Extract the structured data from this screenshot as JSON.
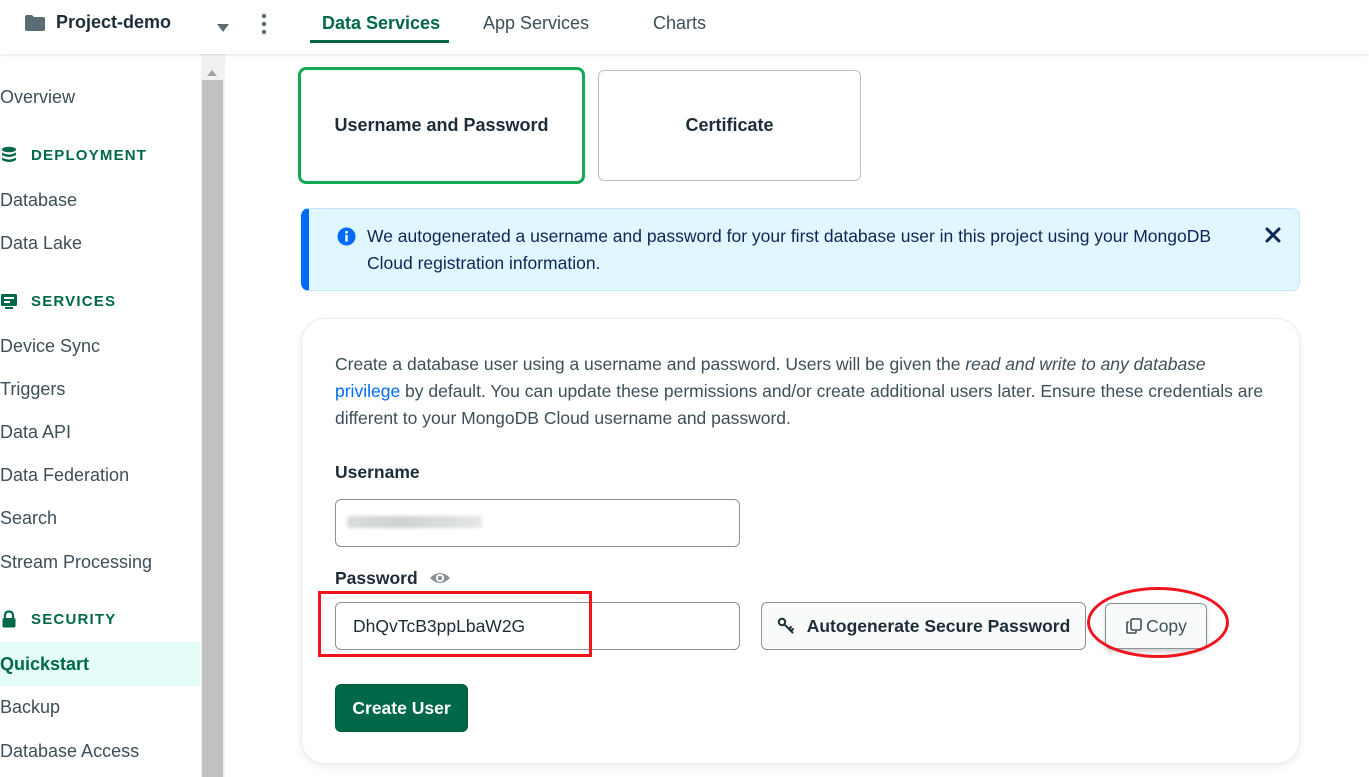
{
  "topbar": {
    "project_name": "Project-demo",
    "tabs": [
      {
        "label": "Data Services",
        "active": true
      },
      {
        "label": "App Services",
        "active": false
      },
      {
        "label": "Charts",
        "active": false
      }
    ],
    "accent_color": "#00684a"
  },
  "sidebar": {
    "overview": "Overview",
    "deployment": {
      "title": "DEPLOYMENT",
      "icon": "database-stack-icon",
      "items": [
        "Database",
        "Data Lake"
      ]
    },
    "services": {
      "title": "SERVICES",
      "icon": "services-icon",
      "items": [
        "Device Sync",
        "Triggers",
        "Data API",
        "Data Federation",
        "Search",
        "Stream Processing"
      ]
    },
    "security": {
      "title": "SECURITY",
      "icon": "lock-icon",
      "items": [
        "Quickstart",
        "Backup",
        "Database Access"
      ],
      "active_item": "Quickstart"
    }
  },
  "auth_methods": {
    "password_label": "Username and Password",
    "certificate_label": "Certificate",
    "selected": "Username and Password"
  },
  "banner": {
    "text": "We autogenerated a username and password for your first database user in this project using your MongoDB Cloud registration information.",
    "icon": "info-icon",
    "color": "#016bf8"
  },
  "form": {
    "description_1": "Create a database user using a username and password. Users will be given the ",
    "description_italic": "read and write to any database",
    "description_link": "privilege",
    "description_2": " by default. You can update these permissions and/or create additional users later. Ensure these credentials are different to your MongoDB Cloud username and password.",
    "username_label": "Username",
    "password_label": "Password",
    "password_value": "DhQvTcB3ppLbaW2G",
    "autogenerate_label": "Autogenerate Secure Password",
    "copy_label": "Copy",
    "create_label": "Create User"
  },
  "annotations": {
    "highlight_color": "#f0141e"
  }
}
